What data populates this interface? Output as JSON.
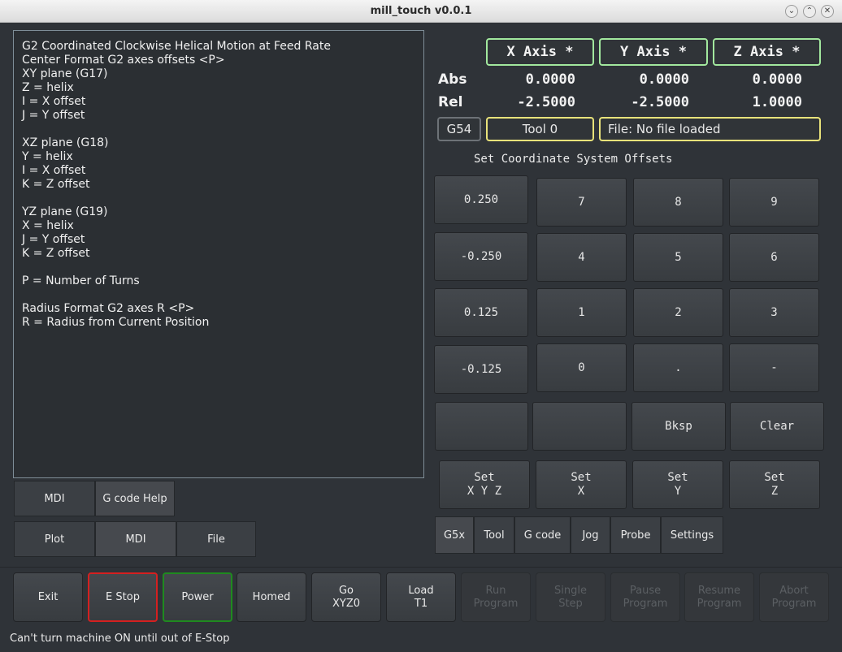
{
  "window": {
    "title": "mill_touch v0.0.1"
  },
  "help": {
    "text": "G2 Coordinated Clockwise Helical Motion at Feed Rate\nCenter Format G2 axes offsets <P>\nXY plane (G17)\nZ = helix\nI = X offset\nJ = Y offset\n\nXZ plane (G18)\nY = helix\nI = X offset\nK = Z offset\n\nYZ plane (G19)\nX = helix\nJ = Y offset\nK = Z offset\n\nP = Number of Turns\n\nRadius Format G2 axes R <P>\nR = Radius from Current Position"
  },
  "left_tabs_row1": [
    "MDI",
    "G code Help"
  ],
  "left_tabs_row2": [
    "Plot",
    "MDI",
    "File"
  ],
  "dro": {
    "axes": [
      "X Axis *",
      "Y Axis *",
      "Z Axis *"
    ],
    "abs_label": "Abs",
    "rel_label": "Rel",
    "abs": [
      "0.0000",
      "0.0000",
      "0.0000"
    ],
    "rel": [
      "-2.5000",
      "-2.5000",
      "1.0000"
    ],
    "axis_border_color": "#a2e89e"
  },
  "status": {
    "coord_system": "G54",
    "tool": "Tool 0",
    "file": "File: No file loaded",
    "highlight_color": "#e8e27a"
  },
  "keypad": {
    "title": "Set Coordinate System Offsets",
    "steps": [
      "0.250",
      "-0.250",
      "0.125",
      "-0.125"
    ],
    "digits": [
      "7",
      "8",
      "9",
      "4",
      "5",
      "6",
      "1",
      "2",
      "3",
      "0",
      ".",
      "-"
    ],
    "row5": [
      "",
      "",
      "Bksp",
      "Clear"
    ],
    "set": [
      "Set\nX Y Z",
      "Set\nX",
      "Set\nY",
      "Set\nZ"
    ]
  },
  "right_tabs": [
    "G5x",
    "Tool",
    "G code",
    "Jog",
    "Probe",
    "Settings"
  ],
  "bottom_buttons": [
    {
      "label": "Exit",
      "enabled": true
    },
    {
      "label": "E Stop",
      "enabled": true,
      "border": "#d42020"
    },
    {
      "label": "Power",
      "enabled": true,
      "border": "#1f8a1f"
    },
    {
      "label": "Homed",
      "enabled": true
    },
    {
      "label": "Go\nXYZ0",
      "enabled": true
    },
    {
      "label": "Load\nT1",
      "enabled": true
    },
    {
      "label": "Run\nProgram",
      "enabled": false
    },
    {
      "label": "Single\nStep",
      "enabled": false
    },
    {
      "label": "Pause\nProgram",
      "enabled": false
    },
    {
      "label": "Resume\nProgram",
      "enabled": false
    },
    {
      "label": "Abort\nProgram",
      "enabled": false
    }
  ],
  "status_message": "Can't turn machine ON until out of E-Stop"
}
